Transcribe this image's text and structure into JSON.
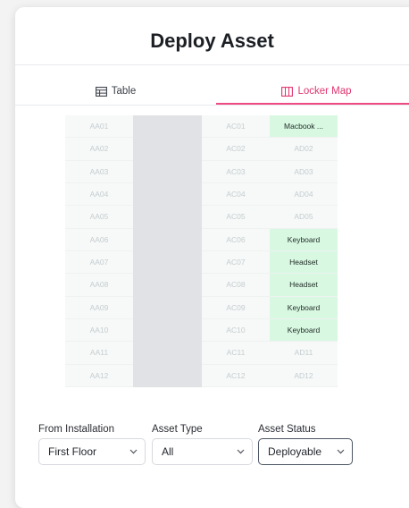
{
  "title": "Deploy Asset",
  "tabs": {
    "table": "Table",
    "locker_map": "Locker Map"
  },
  "locker_map": {
    "column_aa": [
      "AA01",
      "AA02",
      "AA03",
      "AA04",
      "AA05",
      "AA06",
      "AA07",
      "AA08",
      "AA09",
      "AA10",
      "AA11",
      "AA12"
    ],
    "column_ac": [
      "AC01",
      "AC02",
      "AC03",
      "AC04",
      "AC05",
      "AC06",
      "AC07",
      "AC08",
      "AC09",
      "AC10",
      "AC11",
      "AC12"
    ],
    "column_ad": [
      "Macbook ...",
      "AD02",
      "AD03",
      "AD04",
      "AD05",
      "Keyboard",
      "Headset",
      "Headset",
      "Keyboard",
      "Keyboard",
      "AD11",
      "AD12"
    ],
    "column_ad_occupied": [
      true,
      false,
      false,
      false,
      false,
      true,
      true,
      true,
      true,
      true,
      false,
      false
    ]
  },
  "filters": {
    "installation": {
      "label": "From Installation",
      "value": "First Floor"
    },
    "asset_type": {
      "label": "Asset Type",
      "value": "All"
    },
    "asset_status": {
      "label": "Asset Status",
      "value": "Deployable"
    }
  },
  "colors": {
    "accent": "#ee4a83",
    "occupied_cell": "#d8f8e2",
    "empty_cell": "#f6f9f8",
    "divider_column": "#e1e2e6"
  }
}
